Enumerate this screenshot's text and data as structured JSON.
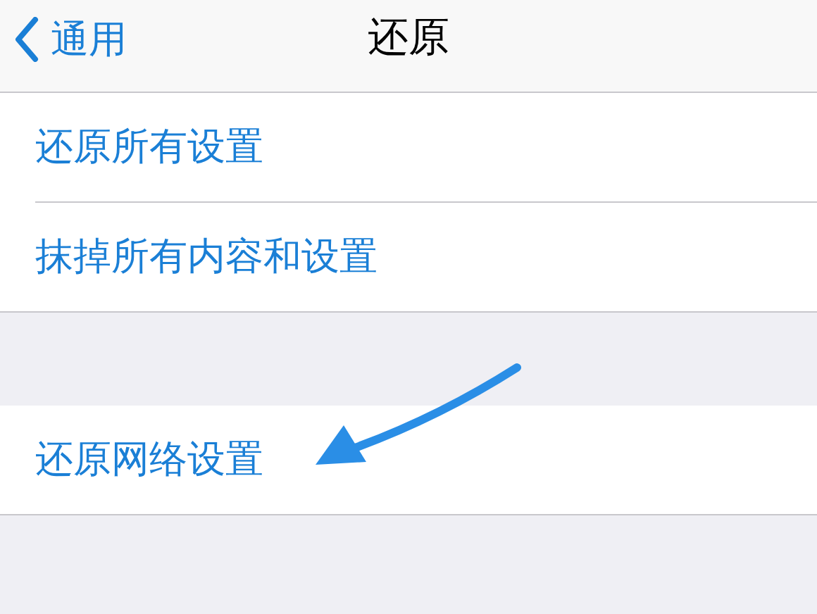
{
  "nav_bar": {
    "back_label": "通用",
    "title": "还原"
  },
  "groups": [
    {
      "items": [
        "还原所有设置",
        "抹掉所有内容和设置"
      ]
    },
    {
      "items": [
        "还原网络设置"
      ]
    }
  ]
}
